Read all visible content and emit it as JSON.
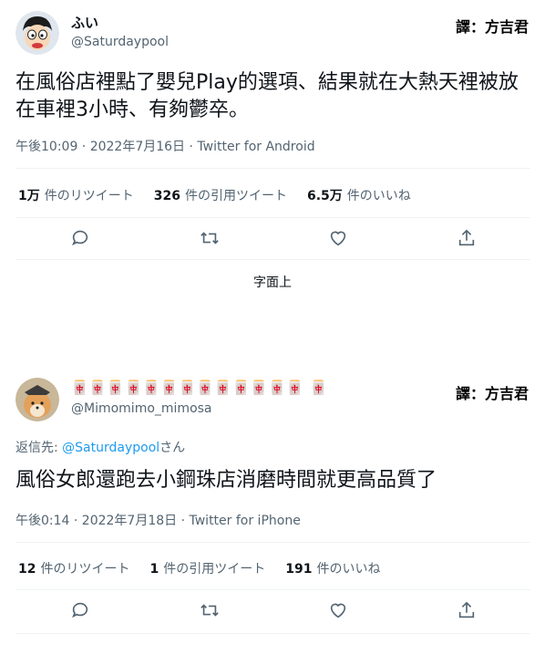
{
  "tweets": [
    {
      "display_name": "ふい",
      "handle": "@Saturdaypool",
      "credit": "譯：方吉君",
      "text": "在風俗店裡點了嬰兒Play的選項、結果就在大熱天裡被放在車裡3小時、有夠鬱卒。",
      "timestamp": "午後10:09 · 2022年7月16日 · Twitter for Android",
      "stats": [
        {
          "value": "1万",
          "label": "件のリツイート"
        },
        {
          "value": "326",
          "label": "件の引用ツイート"
        },
        {
          "value": "6.5万",
          "label": "件のいいね"
        }
      ],
      "actions": [
        "reply-icon",
        "retweet-icon",
        "like-icon",
        "share-icon"
      ]
    },
    {
      "display_name": "🀄🀄🀄🀄🀄🀄🀄🀄🀄🀄🀄🀄🀄 🀄",
      "handle": "@Mimomimo_mimosa",
      "credit": "譯：方吉君",
      "reply_prefix": "返信先: ",
      "reply_link": "@Saturdaypool",
      "reply_suffix": "さん",
      "text": "風俗女郎還跑去小鋼珠店消磨時間就更高品質了",
      "timestamp": "午後0:14 · 2022年7月18日 · Twitter for iPhone",
      "stats": [
        {
          "value": "12",
          "label": "件のリツイート"
        },
        {
          "value": "1",
          "label": "件の引用ツイート"
        },
        {
          "value": "191",
          "label": "件のいいね"
        }
      ],
      "actions": [
        "reply-icon",
        "retweet-icon",
        "like-icon",
        "share-icon"
      ]
    }
  ],
  "caption": "字面上",
  "colors": {
    "link": "#1d9bf0",
    "muted": "#536471",
    "text": "#0f1419",
    "divider": "#eff3f4"
  }
}
